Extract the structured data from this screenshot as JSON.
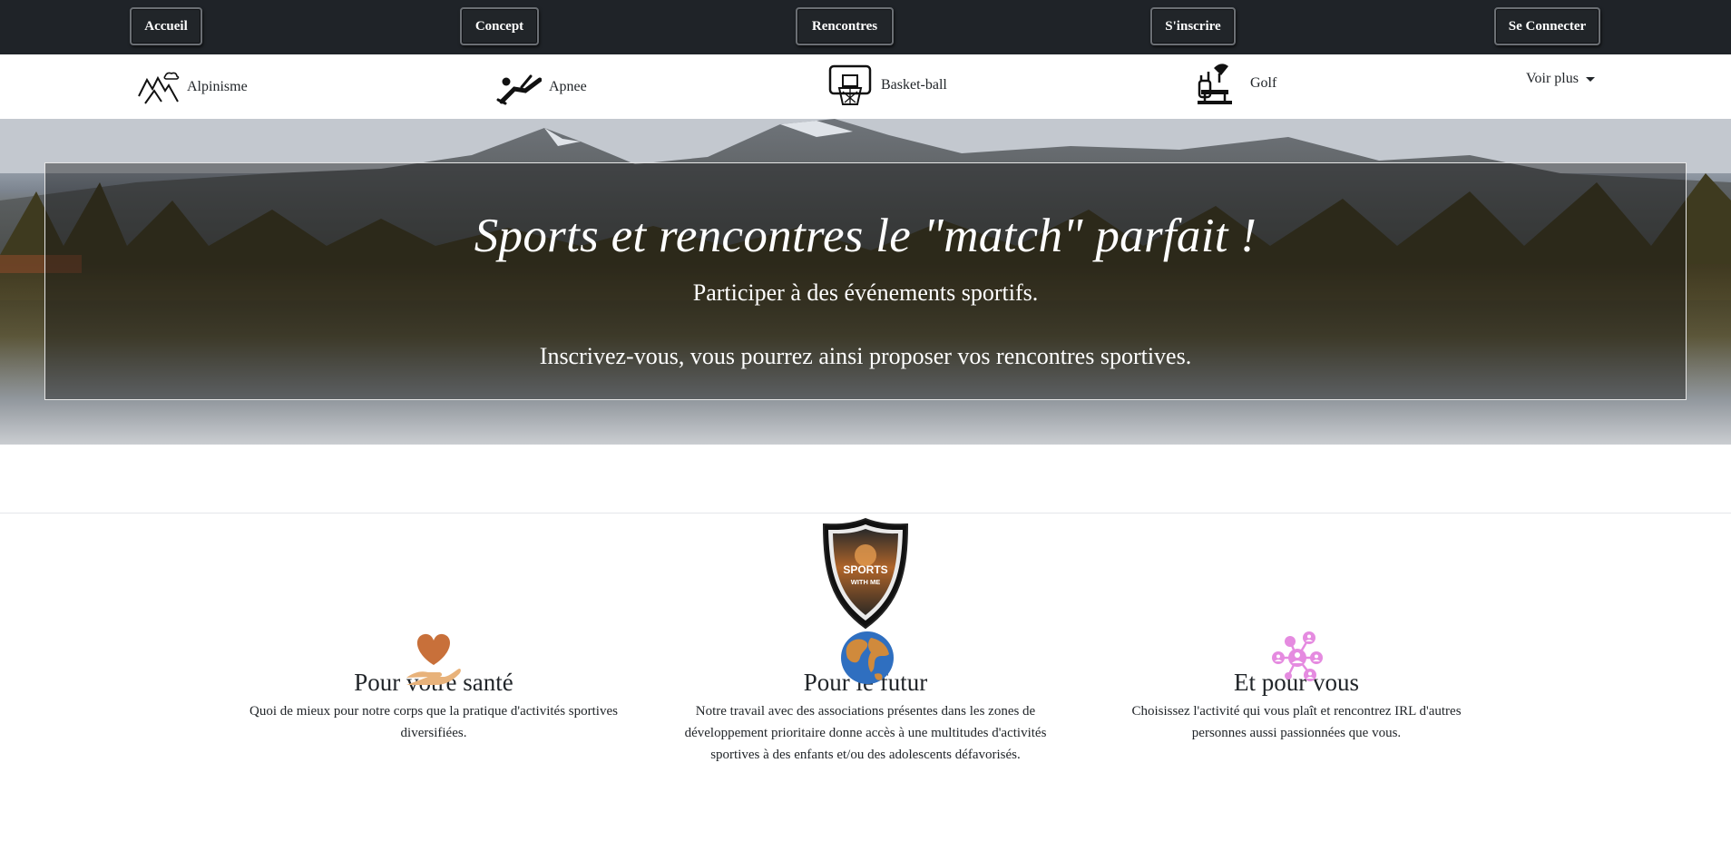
{
  "topnav": {
    "home": "Accueil",
    "concept": "Concept",
    "meetings": "Rencontres",
    "signup": "S'inscrire",
    "login": "Se Connecter"
  },
  "sports": {
    "items": [
      {
        "label": "Alpinisme",
        "icon": "mountain-icon"
      },
      {
        "label": "Apnee",
        "icon": "diver-icon"
      },
      {
        "label": "Basket-ball",
        "icon": "basketball-hoop-icon"
      },
      {
        "label": "Golf",
        "icon": "golf-icon"
      }
    ],
    "more": "Voir plus"
  },
  "hero": {
    "title": "Sports et rencontres le \"match\" parfait !",
    "line1": "Participer à des événements sportifs.",
    "line2": "Inscrivez-vous, vous pourrez ainsi proposer vos rencontres sportives."
  },
  "logo": {
    "line1": "SPORTS",
    "line2": "WITH ME"
  },
  "features": [
    {
      "icon": "heart-hand-icon",
      "title": "Pour votre santé",
      "text": "Quoi de mieux pour notre corps que la pratique d'activités sportives diversifiées."
    },
    {
      "icon": "globe-icon",
      "title": "Pour le futur",
      "text": "Notre travail avec des associations présentes dans les zones de développement prioritaire donne accès à une multitudes d'activités sportives à des enfants et/ou des adolescents défavorisés."
    },
    {
      "icon": "network-people-icon",
      "title": "Et pour vous",
      "text": "Choisissez l'activité qui vous plaît et rencontrez IRL d'autres personnes aussi passionnées que vous."
    }
  ],
  "colors": {
    "nav_bg": "#1f2328",
    "heart": "#c8703a",
    "globe_sea": "#2f6fc0",
    "globe_land": "#d08a3c",
    "network": "#e58be0"
  }
}
